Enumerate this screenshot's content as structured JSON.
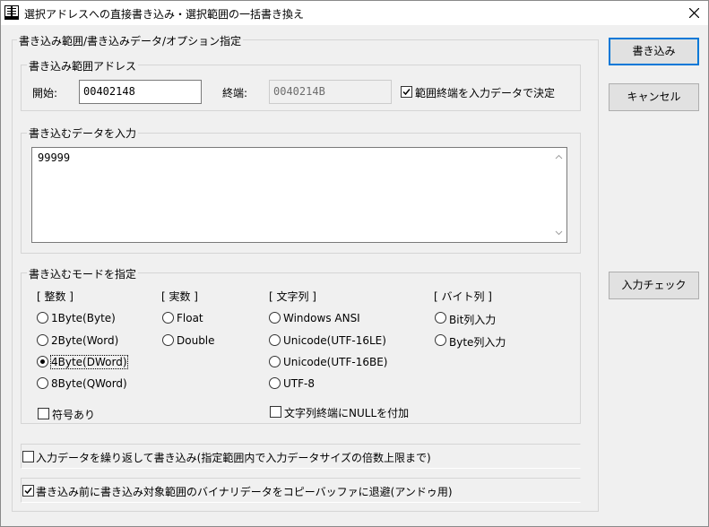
{
  "window": {
    "title": "選択アドレスへの直接書き込み・選択範囲の一括書き換え"
  },
  "buttons": {
    "write": "書き込み",
    "cancel": "キャンセル",
    "check_input": "入力チェック"
  },
  "main_group": {
    "legend": "書き込み範囲/書き込みデータ/オプション指定"
  },
  "range_group": {
    "legend": "書き込み範囲アドレス",
    "start_label": "開始:",
    "start_value": "00402148",
    "end_label": "終端:",
    "end_value": "0040214B",
    "end_by_data_label": "範囲終端を入力データで決定",
    "end_by_data_checked": true
  },
  "data_group": {
    "legend": "書き込むデータを入力",
    "value": "99999"
  },
  "mode_group": {
    "legend": "書き込むモードを指定",
    "integer": {
      "header": "[ 整数 ]",
      "options": [
        "1Byte(Byte)",
        "2Byte(Word)",
        "4Byte(DWord)",
        "8Byte(QWord)"
      ],
      "selected": "4Byte(DWord)",
      "signed_label": "符号あり",
      "signed_checked": false
    },
    "real": {
      "header": "[ 実数 ]",
      "options": [
        "Float",
        "Double"
      ]
    },
    "string": {
      "header": "[ 文字列 ]",
      "options": [
        "Windows ANSI",
        "Unicode(UTF-16LE)",
        "Unicode(UTF-16BE)",
        "UTF-8"
      ],
      "null_terminate_label": "文字列終端にNULLを付加",
      "null_terminate_checked": false
    },
    "bytes": {
      "header": "[ バイト列 ]",
      "options": [
        "Bit列入力",
        "Byte列入力"
      ]
    }
  },
  "options": {
    "repeat_label": "入力データを繰り返して書き込み(指定範囲内で入力データサイズの倍数上限まで)",
    "repeat_checked": false,
    "backup_label": "書き込み前に書き込み対象範囲のバイナリデータをコピーバッファに退避(アンドゥ用)",
    "backup_checked": true
  },
  "icons": {
    "app": "app-icon",
    "close": "close-icon",
    "scroll_up": "scroll-up-icon",
    "scroll_down": "scroll-down-icon"
  }
}
